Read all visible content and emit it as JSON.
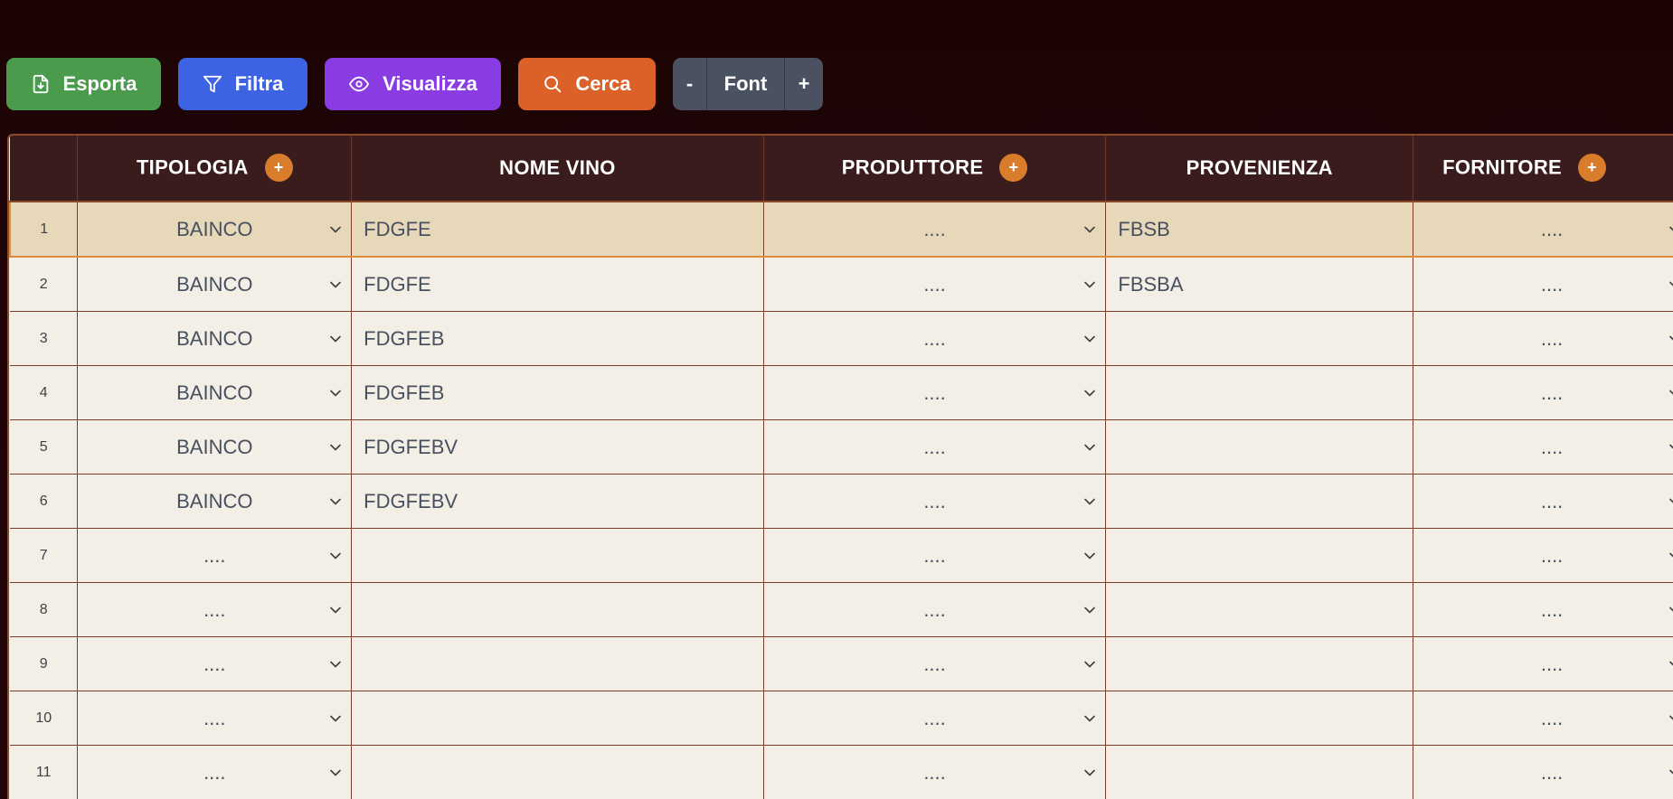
{
  "toolbar": {
    "export_label": "Esporta",
    "filter_label": "Filtra",
    "view_label": "Visualizza",
    "search_label": "Cerca",
    "font_minus": "-",
    "font_label": "Font",
    "font_plus": "+"
  },
  "table": {
    "headers": {
      "tipologia": "TIPOLOGIA",
      "nome_vino": "NOME VINO",
      "produttore": "PRODUTTORE",
      "provenienza": "PROVENIENZA",
      "fornitore": "FORNITORE"
    },
    "add_symbol": "+",
    "rows": [
      {
        "n": "1",
        "tipologia": "BAINCO",
        "nome_vino": "FDGFE",
        "produttore": "....",
        "provenienza": "FBSB",
        "fornitore": "...."
      },
      {
        "n": "2",
        "tipologia": "BAINCO",
        "nome_vino": "FDGFE",
        "produttore": "....",
        "provenienza": "FBSBA",
        "fornitore": "...."
      },
      {
        "n": "3",
        "tipologia": "BAINCO",
        "nome_vino": "FDGFEB",
        "produttore": "....",
        "provenienza": "",
        "fornitore": "...."
      },
      {
        "n": "4",
        "tipologia": "BAINCO",
        "nome_vino": "FDGFEB",
        "produttore": "....",
        "provenienza": "",
        "fornitore": "...."
      },
      {
        "n": "5",
        "tipologia": "BAINCO",
        "nome_vino": "FDGFEBV",
        "produttore": "....",
        "provenienza": "",
        "fornitore": "...."
      },
      {
        "n": "6",
        "tipologia": "BAINCO",
        "nome_vino": "FDGFEBV",
        "produttore": "....",
        "provenienza": "",
        "fornitore": "...."
      },
      {
        "n": "7",
        "tipologia": "....",
        "nome_vino": "",
        "produttore": "....",
        "provenienza": "",
        "fornitore": "...."
      },
      {
        "n": "8",
        "tipologia": "....",
        "nome_vino": "",
        "produttore": "....",
        "provenienza": "",
        "fornitore": "...."
      },
      {
        "n": "9",
        "tipologia": "....",
        "nome_vino": "",
        "produttore": "....",
        "provenienza": "",
        "fornitore": "...."
      },
      {
        "n": "10",
        "tipologia": "....",
        "nome_vino": "",
        "produttore": "....",
        "provenienza": "",
        "fornitore": "...."
      },
      {
        "n": "11",
        "tipologia": "....",
        "nome_vino": "",
        "produttore": "....",
        "provenienza": "",
        "fornitore": "...."
      }
    ],
    "selected_row": "1"
  },
  "colors": {
    "background": "#210507",
    "header_bg": "#3a1c1c",
    "row_bg": "#f4efe6",
    "selected_row_bg": "#e6d8b9",
    "accent_orange": "#d97c2b",
    "export_green": "#4a9b4c",
    "filter_blue": "#3d63e2",
    "view_purple": "#8a3ce3",
    "search_orange": "#db6128",
    "font_gray": "#4a5161"
  }
}
